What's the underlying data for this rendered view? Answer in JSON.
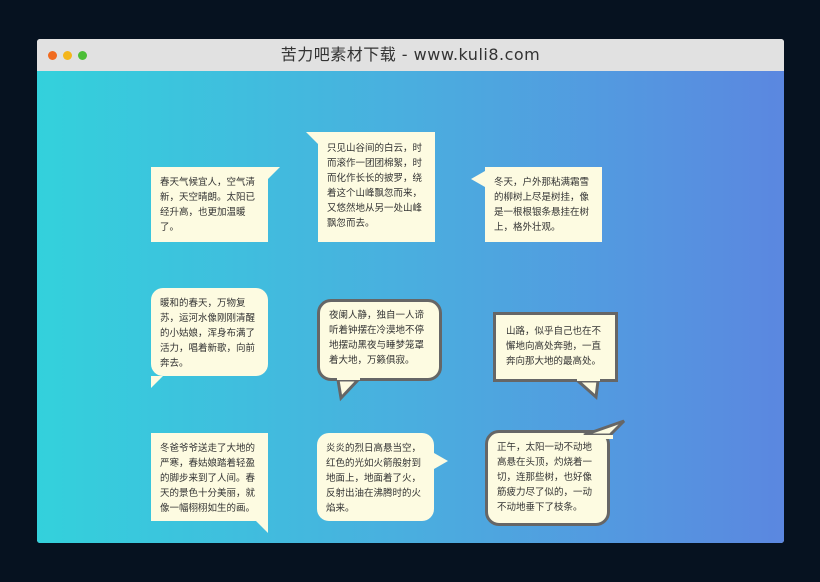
{
  "window": {
    "title": "苦力吧素材下载 - www.kuli8.com"
  },
  "colors": {
    "bubble_bg": "#fdfbe1",
    "bubble_border": "#666666",
    "gradient_start": "#33d1dc",
    "gradient_end": "#5b87e0"
  },
  "bubbles": [
    {
      "text": "春天气候宜人，空气清新，天空晴朗。太阳已经升高，也更加温暖了。"
    },
    {
      "text": "只见山谷间的白云，时而滚作一团团棉絮，时而化作长长的披罗，绕着这个山峰飘忽而来，又悠然地从另一处山峰飘忽而去。"
    },
    {
      "text": "冬天，户外那粘满霜雪的柳树上尽是树挂，像是一根根银条悬挂在树上，格外壮观。"
    },
    {
      "text": "暖和的春天，万物复苏，运河水像刚刚清醒的小姑娘，浑身布满了活力，唱着新歌，向前奔去。"
    },
    {
      "text": "夜阑人静，独自一人谛听着钟摆在冷漠地不停地摆动黑夜与睡梦笼罩着大地，万籁俱寂。"
    },
    {
      "text": "山路，似乎自己也在不懈地向高处奔驰，一直奔向那大地的最高处。"
    },
    {
      "text": "冬爸爷爷送走了大地的严寒，春姑娘踏着轻盈的脚步来到了人间。春天的景色十分美丽，就像一幅栩栩如生的画。"
    },
    {
      "text": "炎炎的烈日高悬当空，红色的光如火箭般射到地面上，地面着了火，反射出油在沸腾时的火焰来。"
    },
    {
      "text": "正午，太阳一动不动地高悬在头顶，灼烧着一切，连那些树，也好像筋疲力尽了似的，一动不动地垂下了枝条。"
    }
  ]
}
